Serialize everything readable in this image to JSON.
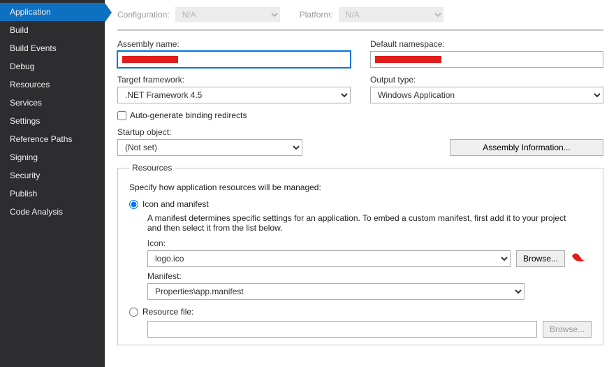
{
  "sidebar": {
    "items": [
      "Application",
      "Build",
      "Build Events",
      "Debug",
      "Resources",
      "Services",
      "Settings",
      "Reference Paths",
      "Signing",
      "Security",
      "Publish",
      "Code Analysis"
    ],
    "selected": 0
  },
  "config": {
    "config_label": "Configuration:",
    "config_value": "N/A",
    "platform_label": "Platform:",
    "platform_value": "N/A"
  },
  "form": {
    "assembly_name_label": "Assembly name:",
    "assembly_name_value": "",
    "default_namespace_label": "Default namespace:",
    "default_namespace_value": "",
    "target_framework_label": "Target framework:",
    "target_framework_value": ".NET Framework 4.5",
    "output_type_label": "Output type:",
    "output_type_value": "Windows Application",
    "auto_generate_label": "Auto-generate binding redirects",
    "startup_object_label": "Startup object:",
    "startup_object_value": "(Not set)",
    "assembly_info_button": "Assembly Information..."
  },
  "resources": {
    "legend": "Resources",
    "desc": "Specify how application resources will be managed:",
    "icon_manifest_label": "Icon and manifest",
    "hint": "A manifest determines specific settings for an application. To embed a custom manifest, first add it to your project and then select it from the list below.",
    "icon_label": "Icon:",
    "icon_value": "logo.ico",
    "browse_label": "Browse...",
    "manifest_label": "Manifest:",
    "manifest_value": "Properties\\app.manifest",
    "resource_file_label": "Resource file:"
  }
}
